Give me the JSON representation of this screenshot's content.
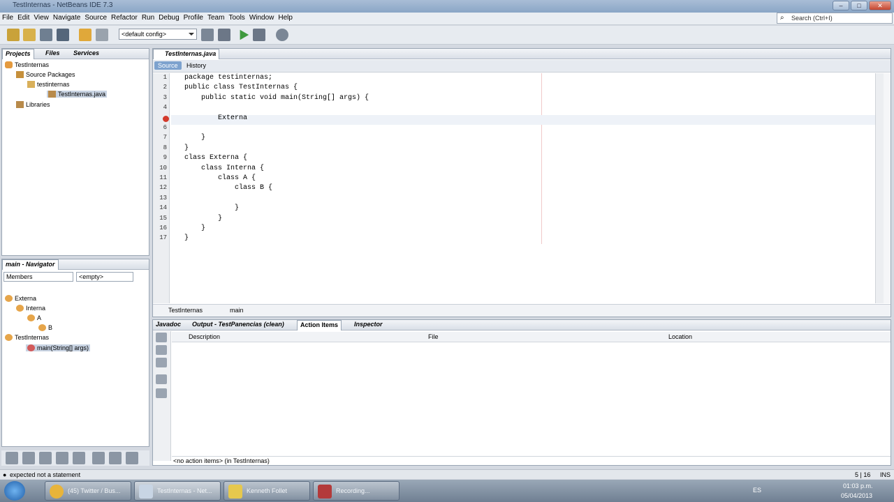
{
  "window": {
    "title": "TestInternas - NetBeans IDE 7.3"
  },
  "menu": [
    "File",
    "Edit",
    "View",
    "Navigate",
    "Source",
    "Refactor",
    "Run",
    "Debug",
    "Profile",
    "Team",
    "Tools",
    "Window",
    "Help"
  ],
  "search": {
    "placeholder": "Search (Ctrl+I)"
  },
  "toolbar": {
    "config": "<default config>"
  },
  "projects": {
    "tabs": [
      "Projects",
      "Files",
      "Services"
    ],
    "tree": [
      "TestInternas",
      "Source Packages",
      "testinternas",
      "TestInternas.java",
      "Libraries"
    ]
  },
  "navigator": {
    "title": "main - Navigator",
    "filter": "Members",
    "empty": "<empty>",
    "tree": [
      "Externa",
      "Interna",
      "A",
      "B",
      "TestInternas",
      "main(String[] args)"
    ]
  },
  "editor": {
    "tab": "TestInternas.java",
    "source_tab": "Source",
    "history_tab": "History",
    "lines": [
      {
        "n": "1",
        "t": "package testinternas;"
      },
      {
        "n": "2",
        "t": "public class TestInternas {"
      },
      {
        "n": "3",
        "t": "    public static void main(String[] args) {"
      },
      {
        "n": "4",
        "t": ""
      },
      {
        "n": "",
        "t": "        Externa"
      },
      {
        "n": "6",
        "t": ""
      },
      {
        "n": "7",
        "t": "    }"
      },
      {
        "n": "8",
        "t": "}"
      },
      {
        "n": "9",
        "t": "class Externa {"
      },
      {
        "n": "10",
        "t": "    class Interna {"
      },
      {
        "n": "11",
        "t": "        class A {"
      },
      {
        "n": "12",
        "t": "            class B {"
      },
      {
        "n": "13",
        "t": ""
      },
      {
        "n": "14",
        "t": "            }"
      },
      {
        "n": "15",
        "t": "        }"
      },
      {
        "n": "16",
        "t": "    }"
      },
      {
        "n": "17",
        "t": "}"
      }
    ],
    "breadcrumb": [
      "TestInternas",
      "main"
    ]
  },
  "bottom": {
    "tabs": [
      "Javadoc",
      "Output - TestPanencias (clean)",
      "Action Items",
      "Inspector"
    ],
    "columns": [
      "Description",
      "File",
      "Location"
    ],
    "footer": "<no action items>   (in TestInternas)"
  },
  "status": {
    "message": "expected  not a statement",
    "position": "5 | 16",
    "mode": "INS"
  },
  "taskbar": {
    "items": [
      "(45) Twitter / Bus...",
      "TestInternas - Net...",
      "Kenneth Follet",
      "Recording..."
    ],
    "lang": "ES",
    "time": "01:03 p.m.",
    "date": "05/04/2013"
  },
  "colors": {
    "accent": "#7da2ce",
    "error": "#d33a2c"
  }
}
